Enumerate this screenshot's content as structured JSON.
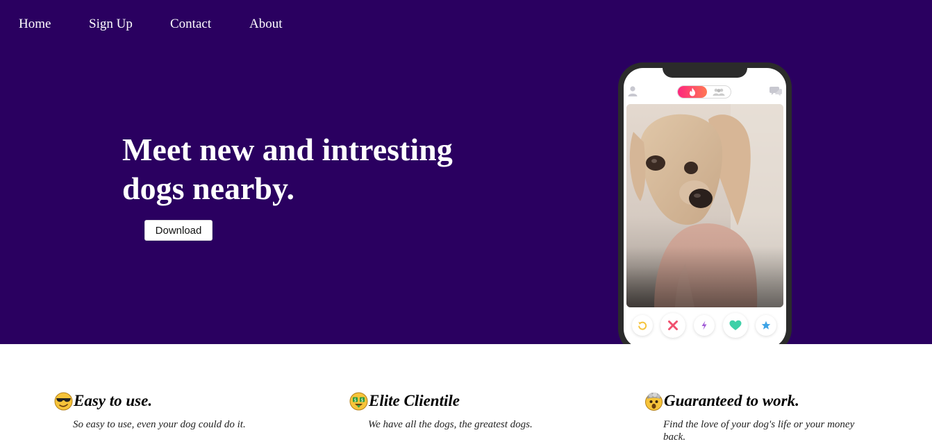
{
  "nav": {
    "items": [
      {
        "label": "Home"
      },
      {
        "label": "Sign Up"
      },
      {
        "label": "Contact"
      },
      {
        "label": "About"
      }
    ]
  },
  "hero": {
    "headline": "Meet new and intresting dogs nearby.",
    "download_label": "Download",
    "background_color": "#2a0060"
  },
  "phone": {
    "icons": [
      "profile-icon",
      "flame-icon",
      "people-icon",
      "chat-icon"
    ],
    "actions": [
      "rewind-icon",
      "nope-icon",
      "boost-icon",
      "like-icon",
      "superlike-icon"
    ],
    "brand_gradient": [
      "#fd267d",
      "#ff7854"
    ]
  },
  "features": [
    {
      "emoji": "cool-face-emoji",
      "title": "Easy to use.",
      "text": "So easy to use, even your dog could do it."
    },
    {
      "emoji": "money-face-emoji",
      "title": "Elite Clientile",
      "text": "We have all the dogs, the greatest dogs."
    },
    {
      "emoji": "mind-blown-emoji",
      "title": "Guaranteed to work.",
      "text": "Find the love of your dog's life or your money back."
    }
  ]
}
